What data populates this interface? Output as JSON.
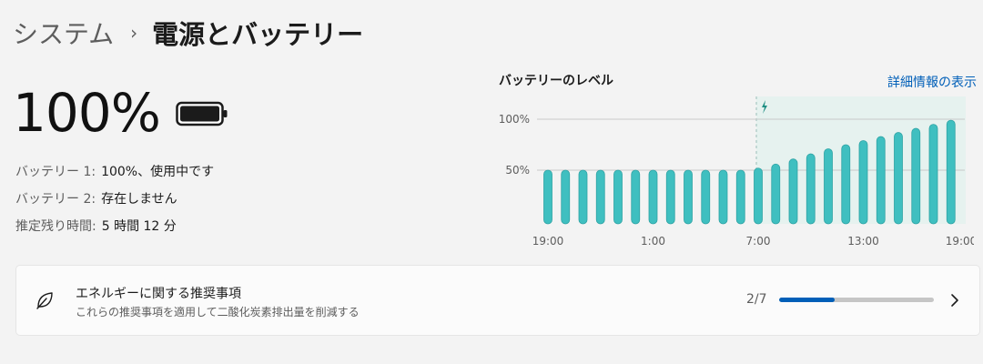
{
  "breadcrumb": {
    "parent": "システム",
    "separator": "›",
    "current": "電源とバッテリー"
  },
  "battery": {
    "percent_text": "100%",
    "level": 1.0,
    "rows": [
      {
        "key": "バッテリー 1:",
        "value": "100%、使用中です"
      },
      {
        "key": "バッテリー 2:",
        "value": "存在しません"
      },
      {
        "key": "推定残り時間:",
        "value": "5 時間 12 分"
      }
    ]
  },
  "chart": {
    "title": "バッテリーのレベル",
    "details_link": "詳細情報の表示"
  },
  "chart_data": {
    "type": "bar",
    "title": "バッテリーのレベル",
    "xlabel": "",
    "ylabel": "",
    "ylim": [
      0,
      100
    ],
    "y_ticks": [
      {
        "value": 100,
        "label": "100%"
      },
      {
        "value": 50,
        "label": "50%"
      }
    ],
    "x_tick_labels": [
      "19:00",
      "1:00",
      "7:00",
      "13:00",
      "19:00"
    ],
    "x_tick_bar_indices": [
      0,
      6,
      12,
      18,
      24
    ],
    "charging_start_index": 12,
    "values": [
      50,
      50,
      50,
      50,
      50,
      50,
      50,
      50,
      50,
      50,
      50,
      50,
      52,
      56,
      61,
      66,
      71,
      75,
      79,
      83,
      87,
      91,
      95,
      99
    ],
    "grid": true,
    "bar_color": "#3fbfc0",
    "charging_band_color": "#e6f2ef"
  },
  "recommendations": {
    "title": "エネルギーに関する推奨事項",
    "subtitle": "これらの推奨事項を適用して二酸化炭素排出量を削減する",
    "progress_label": "2/7",
    "progress_fraction": 0.3571
  },
  "icons": {
    "battery": "battery-full-icon",
    "charging": "lightning-icon",
    "leaf": "leaf-icon",
    "chevron": "chevron-right-icon"
  },
  "colors": {
    "accent": "#005fb8",
    "bar": "#3fbfc0",
    "background": "#f3f3f3"
  }
}
